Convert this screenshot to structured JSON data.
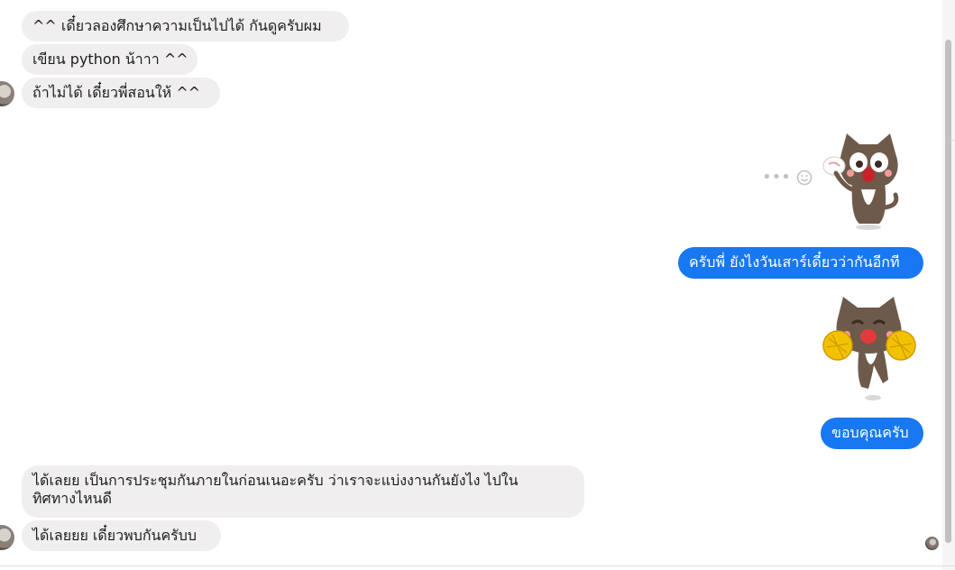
{
  "messages": {
    "incoming_group1": [
      "^^ เดี๋ยวลองศึกษาความเป็นไปได้ กันดูครับผม",
      "เขียน python น้าาา ^^",
      "ถ้าไม่ได้ เดี๋ยวพี่สอนให้ ^^"
    ],
    "outgoing1": "ครับพี่ ยังไงวันเสาร์เดี๋ยวว่ากันอีกที",
    "outgoing2": "ขอบคุณครับ",
    "incoming_group2": [
      "ได้เลยย เป็นการประชุมกันภายในก่อนเนอะครับ ว่าเราจะแบ่งงานกันยังไง ไปใน",
      "ทิศทางไหนดี",
      "ได้เลยยย เดี๋ยวพบกันครับบ"
    ]
  },
  "stickers": {
    "sticker1": "cat-crying-sticker",
    "sticker2": "cat-cheering-pompoms-sticker"
  },
  "icons": {
    "more": "more-dots-icon",
    "reaction": "smiley-icon"
  },
  "colors": {
    "outgoing_bubble": "#1778f2",
    "incoming_bubble": "#f0eeef"
  }
}
